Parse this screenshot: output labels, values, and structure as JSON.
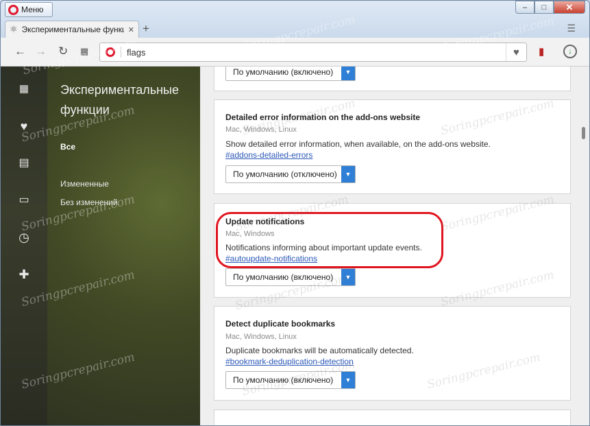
{
  "window": {
    "menu_label": "Меню",
    "controls": {
      "minimize": "–",
      "maximize": "□",
      "close": "✕"
    }
  },
  "tab": {
    "title": "Экспериментальные функции",
    "close_glyph": "✕",
    "new_tab_glyph": "+"
  },
  "toolbar": {
    "address_value": "flags",
    "icons": [
      "back-icon",
      "forward-icon",
      "reload-icon",
      "speed-dial-icon",
      "heart-icon",
      "bookmark-icon",
      "download-icon"
    ]
  },
  "sidebar": {
    "title": "Экспериментальные функции",
    "filters": [
      {
        "label": "Все",
        "active": true
      },
      {
        "label": "Измененные",
        "active": false
      },
      {
        "label": "Без изменений",
        "active": false
      }
    ]
  },
  "cards": [
    {
      "select_value": "По умолчанию (включено)"
    },
    {
      "title": "Detailed error information on the add-ons website",
      "platforms": "Mac, Windows, Linux",
      "description": "Show detailed error information, when available, on the add-ons website.",
      "link": "#addons-detailed-errors",
      "select_value": "По умолчанию (отключено)"
    },
    {
      "title": "Update notifications",
      "platforms": "Mac, Windows",
      "description": "Notifications informing about important update events.",
      "link": "#autoupdate-notifications",
      "select_value": "По умолчанию (включено)"
    },
    {
      "title": "Detect duplicate bookmarks",
      "platforms": "Mac, Windows, Linux",
      "description": "Duplicate bookmarks will be automatically detected.",
      "link": "#bookmark-deduplication-detection",
      "select_value": "По умолчанию (включено)"
    }
  ],
  "watermark": "Soringpcrepair.com",
  "colors": {
    "accent": "#2f7fd6",
    "highlight": "#e0141e",
    "link": "#2b58b8",
    "opera_red": "#e0182d"
  }
}
